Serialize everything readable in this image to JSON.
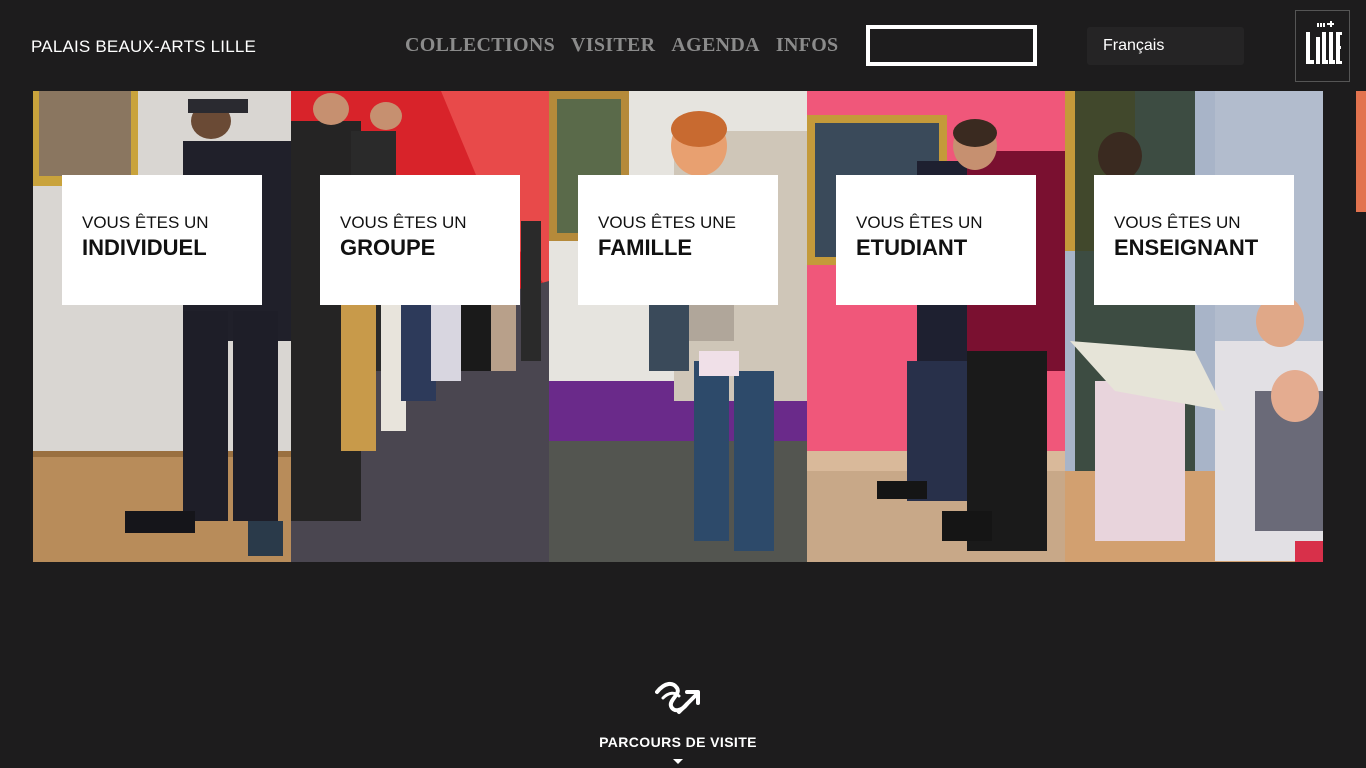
{
  "header": {
    "site_title": "PALAIS BEAUX-ARTS LILLE",
    "nav": [
      "COLLECTIONS",
      "VISITER",
      "AGENDA",
      "INFOS"
    ],
    "search_value": "",
    "language": "Français",
    "logo_text": "ville de LILLE",
    "logo_icon": "ville-de-lille-logo"
  },
  "audiences": [
    {
      "pre": "VOUS ÊTES UN",
      "label": "INDIVIDUEL"
    },
    {
      "pre": "VOUS ÊTES UN",
      "label": "GROUPE"
    },
    {
      "pre": "VOUS ÊTES UNE",
      "label": "FAMILLE"
    },
    {
      "pre": "VOUS ÊTES UN",
      "label": "ETUDIANT"
    },
    {
      "pre": "VOUS ÊTES UN",
      "label": "ENSEIGNANT"
    }
  ],
  "parcours": {
    "label": "PARCOURS DE VISITE",
    "icon": "route-arrow-icon"
  },
  "colors": {
    "background": "#1d1c1d",
    "accent": "#e2734f",
    "nav_text": "#8b8b8b"
  }
}
